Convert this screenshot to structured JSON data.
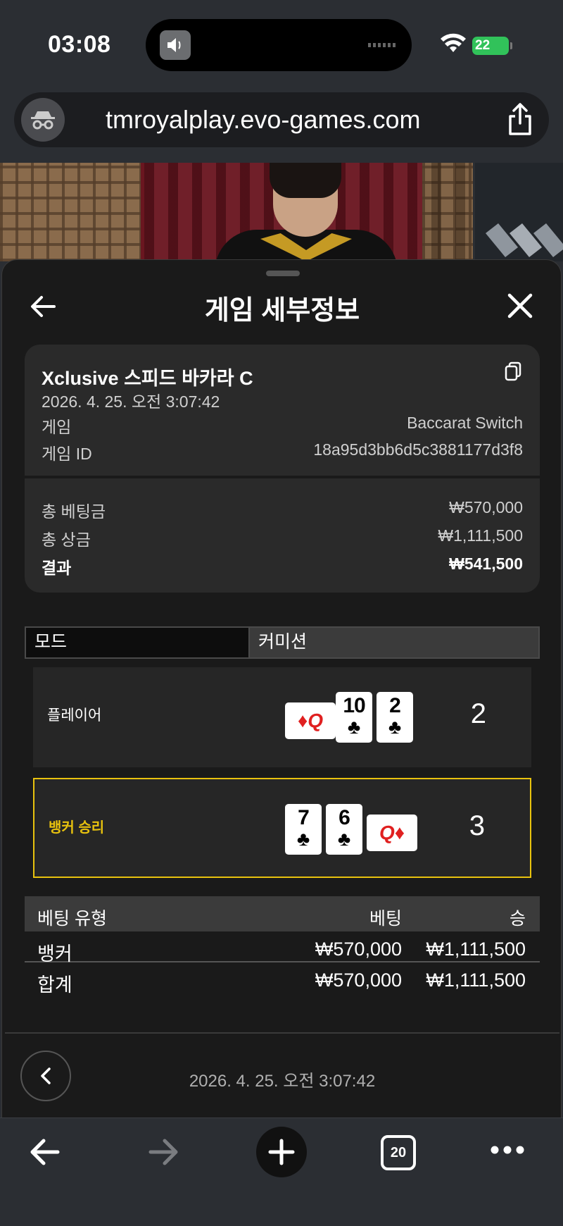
{
  "status_bar": {
    "time": "03:08",
    "battery": "22"
  },
  "browser": {
    "url": "tmroyalplay.evo-games.com",
    "tabs_count": "20"
  },
  "panel": {
    "title": "게임 세부정보",
    "game_name": "Xclusive 스피드 바카라 C",
    "datetime": "2026. 4. 25. 오전 3:07:42",
    "game_label": "게임",
    "game_value": "Baccarat Switch",
    "game_id_label": "게임 ID",
    "game_id_value": "18a95d3bb6d5c3881177d3f8",
    "total_bet_label": "총 베팅금",
    "total_bet_value": "₩570,000",
    "total_payout_label": "총 상금",
    "total_payout_value": "₩1,111,500",
    "result_label": "결과",
    "result_value": "₩541,500"
  },
  "tabs": [
    {
      "label": "모드"
    },
    {
      "label": "커미션"
    }
  ],
  "outcomes": {
    "player": {
      "label": "플레이어",
      "score": "2",
      "cards": [
        {
          "rank": "Q",
          "suit": "♦",
          "sideways": true
        },
        {
          "rank": "10",
          "suit": "♣"
        },
        {
          "rank": "2",
          "suit": "♣"
        }
      ]
    },
    "banker": {
      "label": "뱅커 승리",
      "score": "3",
      "cards": [
        {
          "rank": "7",
          "suit": "♣"
        },
        {
          "rank": "6",
          "suit": "♣"
        },
        {
          "rank": "Q",
          "suit": "♦",
          "sideways": true
        }
      ]
    }
  },
  "bet_table": {
    "headers": [
      "베팅 유형",
      "베팅",
      "승"
    ],
    "rows": [
      {
        "type": "뱅커",
        "bet": "₩570,000",
        "win": "₩1,111,500"
      },
      {
        "type": "합계",
        "bet": "₩570,000",
        "win": "₩1,111,500"
      }
    ]
  },
  "footer": {
    "datetime": "2026. 4. 25. 오전 3:07:42"
  },
  "colors": {
    "winner_highlight": "#e8c20e",
    "battery_green": "#31c25a",
    "panel_bg": "#1a1a1a",
    "red_suit": "#e02020"
  }
}
